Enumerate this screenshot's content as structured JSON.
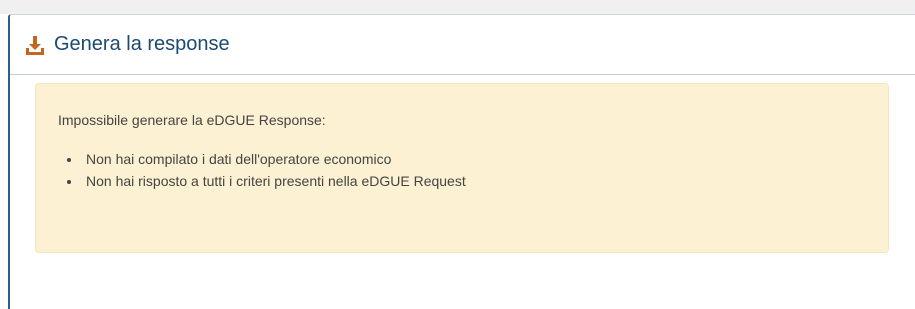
{
  "panel": {
    "icon": "download-icon",
    "title": "Genera la response",
    "accent_color": "#c4661f",
    "title_color": "#1b4a72"
  },
  "alert": {
    "background": "#fdf1d3",
    "message": "Impossibile generare la eDGUE Response:",
    "items": [
      "Non hai compilato i dati dell'operatore economico",
      "Non hai risposto a tutti i criteri presenti nella eDGUE Request"
    ]
  }
}
